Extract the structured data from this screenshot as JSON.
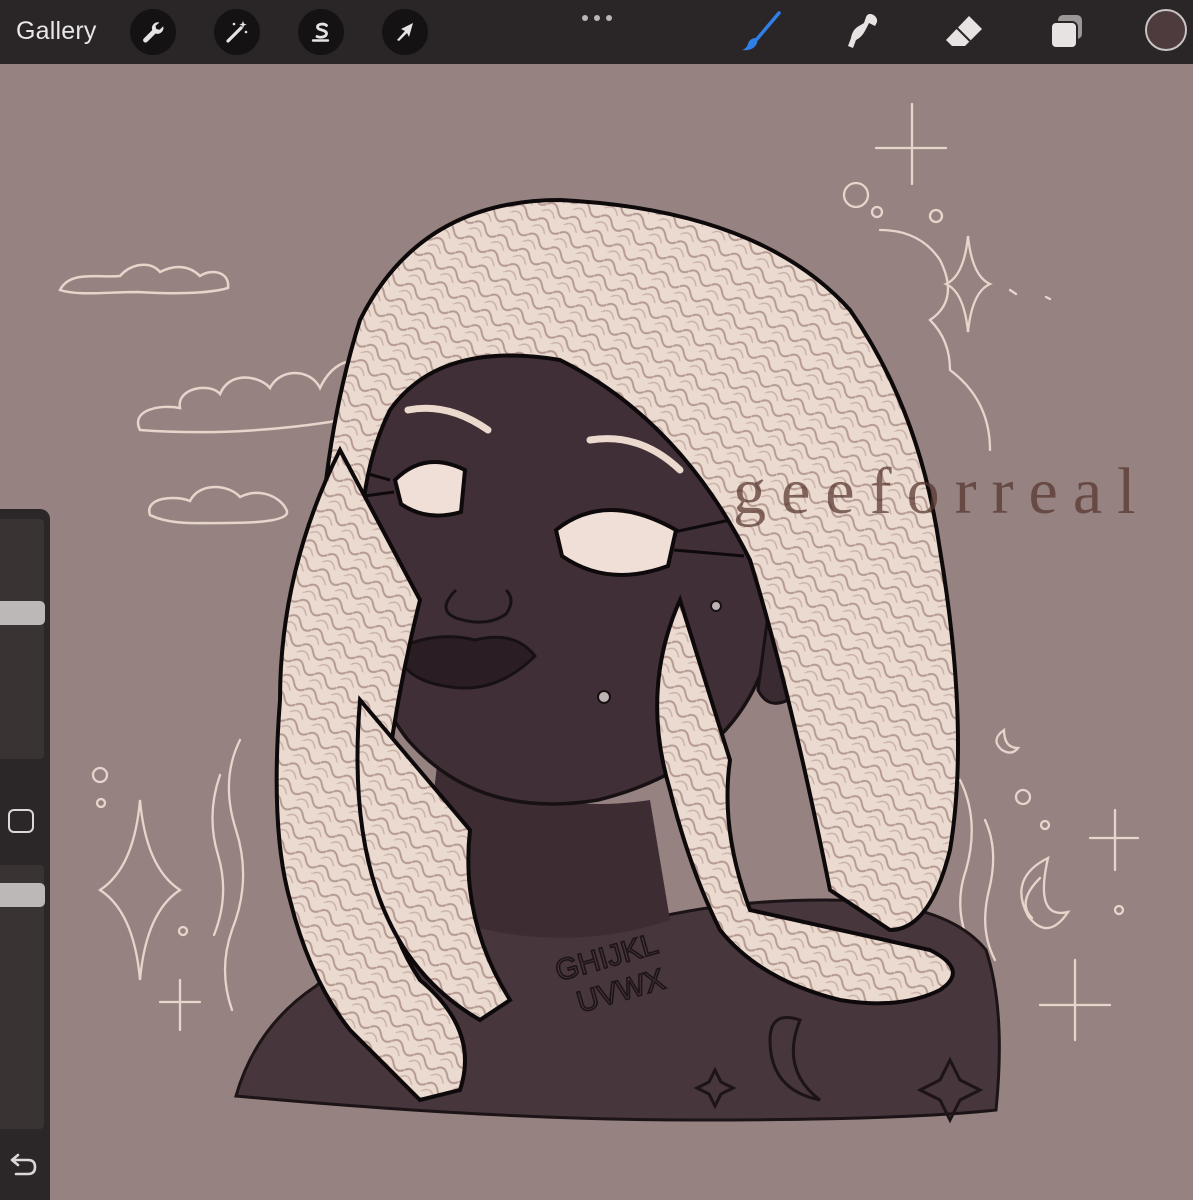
{
  "toolbar": {
    "gallery_label": "Gallery",
    "left_tools": [
      "wrench-icon",
      "magic-wand-icon",
      "selection-s-icon",
      "arrow-transform-icon"
    ],
    "more_icon": "more-dots-icon",
    "right_tools": [
      "brush-icon",
      "smudge-icon",
      "eraser-icon",
      "layers-icon"
    ],
    "active_tool": "brush",
    "active_color": "#4d3b3d",
    "accent": "#2f7fe6"
  },
  "sidebar": {
    "brush_size_slider_icon": "slider-thumb",
    "modify_button_icon": "square-icon",
    "undo_icon": "undo-arrow-icon"
  },
  "canvas": {
    "background": "#968381",
    "watermark": "geeforreal",
    "tattoo_text_line1": "GHIJKL",
    "tattoo_text_line2": "UVWX"
  }
}
